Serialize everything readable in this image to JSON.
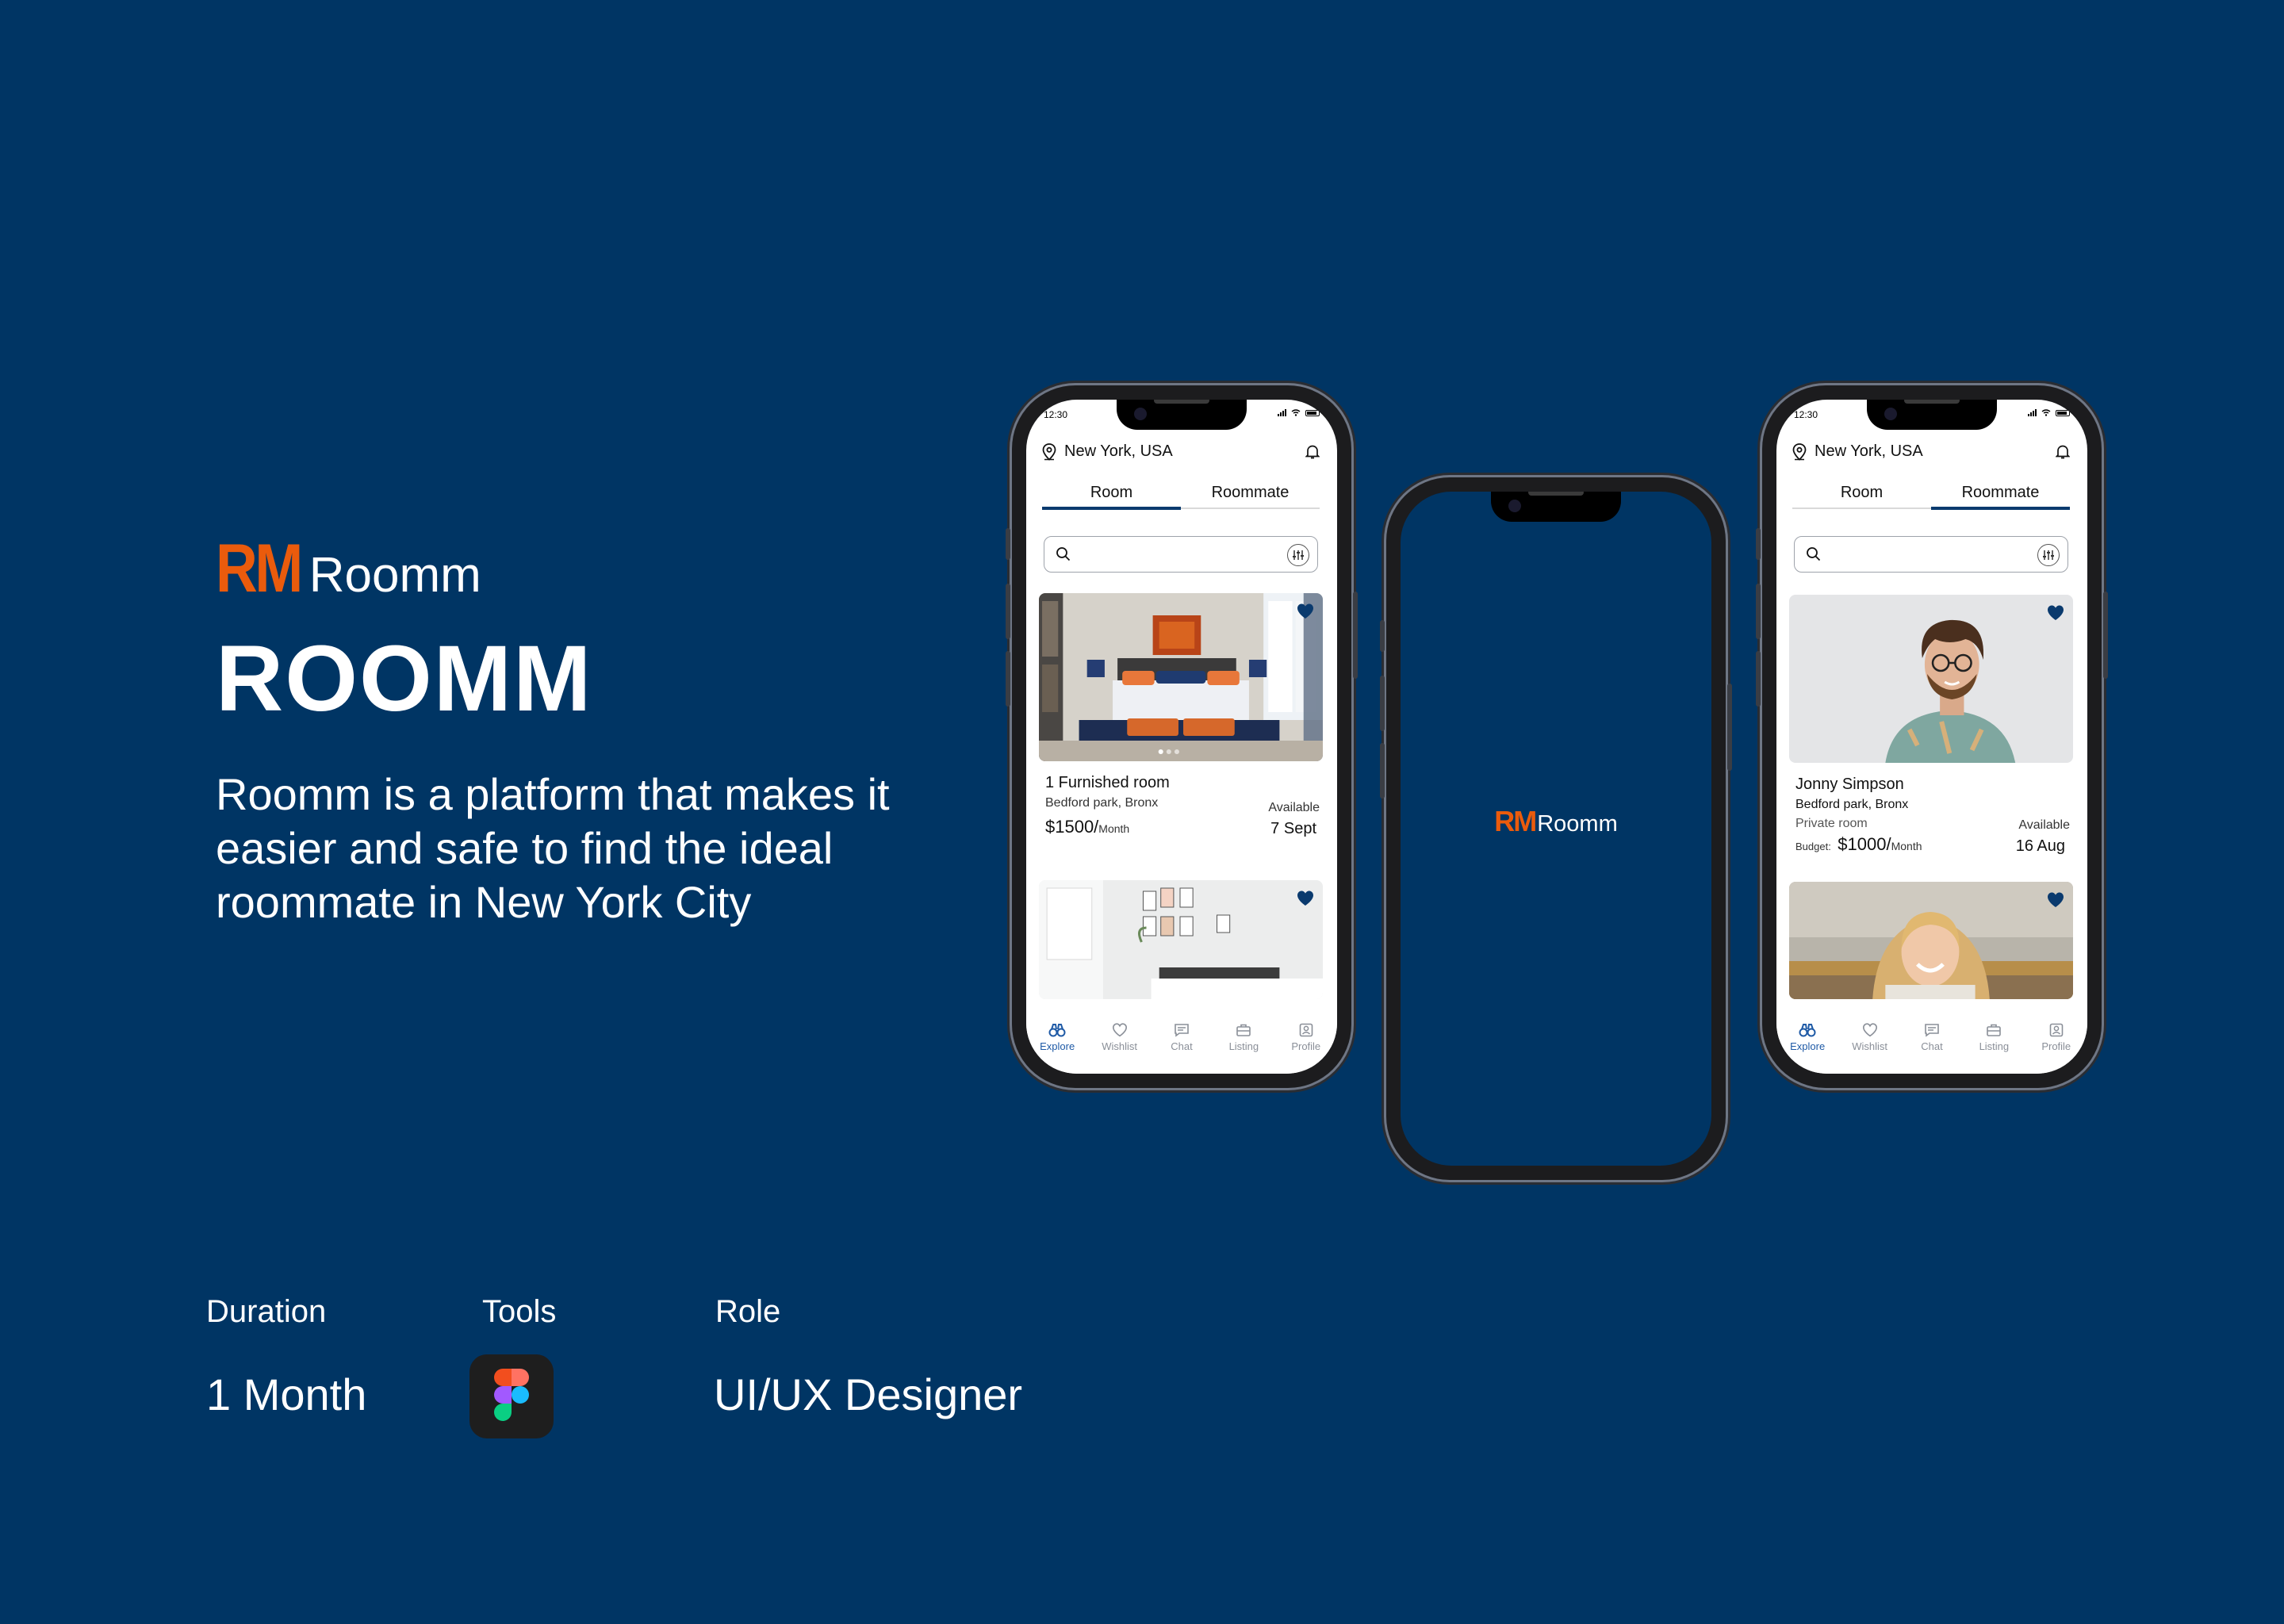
{
  "brand": {
    "mark": "RM",
    "name": "Roomm"
  },
  "hero": {
    "title": "ROOMM",
    "tagline": "Roomm is a platform that makes it easier and safe to find the ideal roommate in New York City"
  },
  "meta": {
    "duration_label": "Duration",
    "duration_value": "1 Month",
    "tools_label": "Tools",
    "tools_icon": "figma-icon",
    "role_label": "Role",
    "role_value": "UI/UX Designer"
  },
  "colors": {
    "background": "#003564",
    "accent": "#ea5b0c",
    "nav_active": "#1f5aa6"
  },
  "phone_room": {
    "time": "12:30",
    "location": "New York, USA",
    "tabs": [
      "Room",
      "Roommate"
    ],
    "active_tab": "Room",
    "card1": {
      "title": "1 Furnished room",
      "location": "Bedford park, Bronx",
      "price": "$1500/",
      "price_unit": "Month",
      "available_label": "Available",
      "available_date": "7 Sept"
    }
  },
  "phone_splash": {
    "mark": "RM",
    "name": "Roomm"
  },
  "phone_roommate": {
    "time": "12:30",
    "location": "New York, USA",
    "tabs": [
      "Room",
      "Roommate"
    ],
    "active_tab": "Roommate",
    "card1": {
      "name": "Jonny Simpson",
      "location": "Bedford park, Bronx",
      "room_type": "Private room",
      "budget_label": "Budget:",
      "budget": "$1000/",
      "budget_unit": "Month",
      "available_label": "Available",
      "available_date": "16 Aug"
    }
  },
  "nav": [
    "Explore",
    "Wishlist",
    "Chat",
    "Listing",
    "Profile"
  ]
}
